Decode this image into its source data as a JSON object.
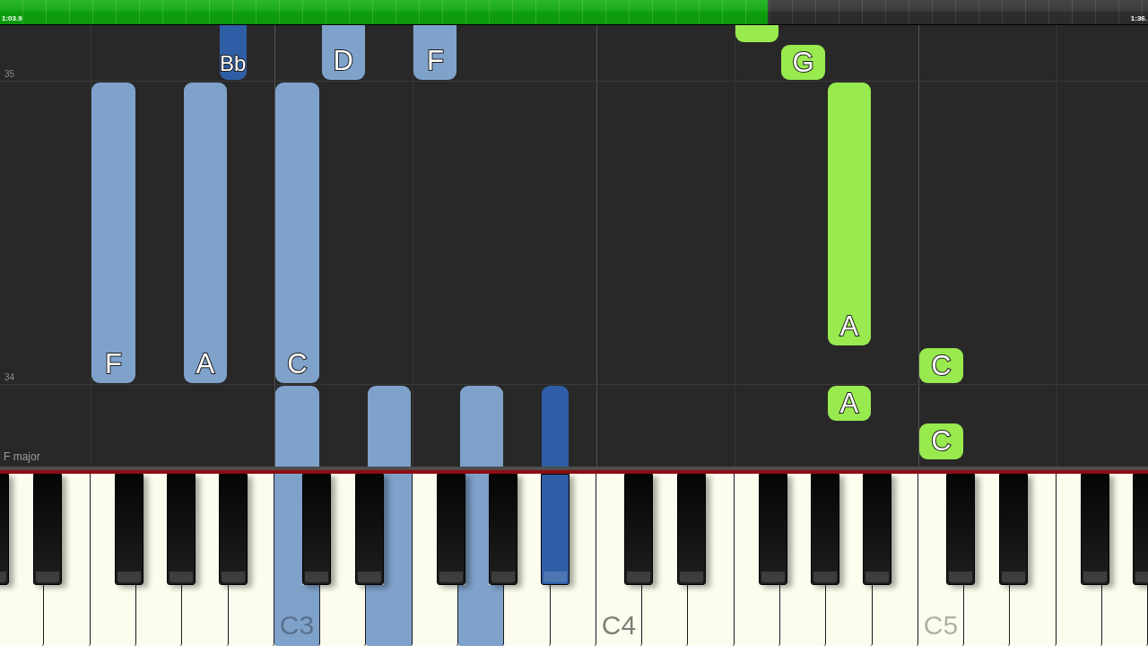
{
  "progress": {
    "level": 0.669,
    "elapsed": "1:03.9",
    "total": "1:36."
  },
  "roll": {
    "measures": [
      {
        "number": "35"
      },
      {
        "number": "34"
      }
    ],
    "key_signature": "F major",
    "notes": [
      {
        "label": "Bb",
        "color": "#2f5ea6",
        "playing": false
      },
      {
        "label": "D",
        "color": "#7fa2cb",
        "playing": false
      },
      {
        "label": "F",
        "color": "#7fa2cb",
        "playing": false
      },
      {
        "color": "#98ea4f",
        "playing": false
      },
      {
        "label": "G",
        "color": "#98ea4f",
        "playing": false
      },
      {
        "label": "F",
        "color": "#7fa2cb",
        "playing": false
      },
      {
        "label": "A",
        "color": "#7fa2cb",
        "playing": false
      },
      {
        "label": "C",
        "color": "#7fa2cb",
        "playing": false
      },
      {
        "label": "A",
        "color": "#98ea4f",
        "playing": false
      },
      {
        "label": "C",
        "color": "#98ea4f",
        "playing": false
      },
      {
        "label": "A",
        "color": "#98ea4f",
        "playing": false
      },
      {
        "label": "C",
        "color": "#98ea4f",
        "playing": false
      },
      {
        "color": "#7fa2cb",
        "playing": true
      },
      {
        "color": "#7fa2cb",
        "playing": true
      },
      {
        "color": "#7fa2cb",
        "playing": true
      },
      {
        "color": "#2f5ea6",
        "playing": true
      }
    ]
  },
  "keyboard": {
    "labels": [
      {
        "text": "C3",
        "emphasized": false
      },
      {
        "text": "C4",
        "emphasized": true
      },
      {
        "text": "C5",
        "emphasized": false
      }
    ]
  }
}
